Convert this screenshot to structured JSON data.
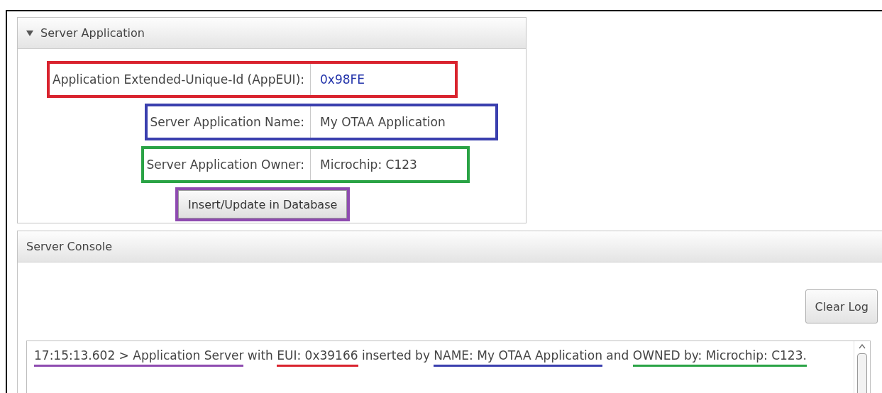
{
  "server_application": {
    "title": "Server Application",
    "expanded": true,
    "fields": [
      {
        "label": "Application Extended-Unique-Id (AppEUI):",
        "value": "0x98FE",
        "color": "#d9232e"
      },
      {
        "label": "Server Application Name:",
        "value": "My OTAA Application",
        "color": "#3a3fae"
      },
      {
        "label": "Server Application Owner:",
        "value": "Microchip: C123",
        "color": "#2aa345"
      }
    ],
    "button": {
      "label": "Insert/Update in Database",
      "color": "#8e4bb0"
    }
  },
  "server_console": {
    "title": "Server Console",
    "clear_button": "Clear Log",
    "log_segments": [
      {
        "text": "17:15:13.602 > Application Server",
        "color": "#8e4bb0"
      },
      {
        "text": " with "
      },
      {
        "text": "EUI: 0x39166",
        "color": "#d9232e"
      },
      {
        "text": " inserted by "
      },
      {
        "text": "NAME: My OTAA Application",
        "color": "#3a3fae"
      },
      {
        "text": " and "
      },
      {
        "text": "OWNED by: Microchip: C123.",
        "color": "#2aa345"
      }
    ]
  }
}
